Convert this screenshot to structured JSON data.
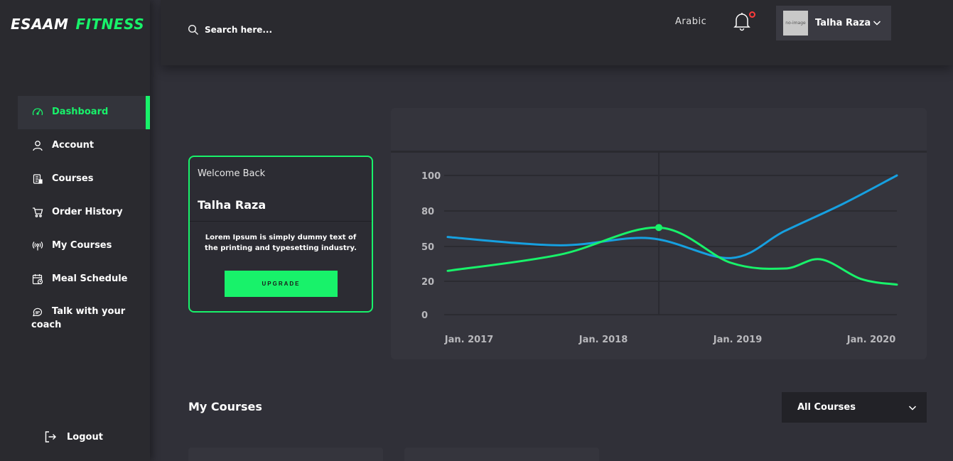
{
  "brand": {
    "part1": "ESAAM",
    "part2": "FITNESS",
    "accent": "#18f26a"
  },
  "sidebar": {
    "items": [
      {
        "label": "Dashboard",
        "icon": "speedometer-icon",
        "active": true
      },
      {
        "label": "Account",
        "icon": "user-icon"
      },
      {
        "label": "Courses",
        "icon": "clipboard-icon"
      },
      {
        "label": "Order History",
        "icon": "cart-icon"
      },
      {
        "label": "My Courses",
        "icon": "broadcast-icon"
      },
      {
        "label": "Meal Schedule",
        "icon": "calendar-icon"
      },
      {
        "label_line1": "Talk with your",
        "label_line2": "coach",
        "icon": "chat-icon"
      }
    ],
    "logout": "Logout"
  },
  "header": {
    "search_placeholder": "Search here...",
    "language": "Arabic",
    "user_name": "Talha Raza",
    "avatar_text": "no-image"
  },
  "welcome": {
    "greeting": "Welcome Back",
    "name": "Talha Raza",
    "description": "Lorem Ipsum is simply dummy text of the printing and typesetting industry.",
    "button": "UPGRADE"
  },
  "chart_data": {
    "type": "line",
    "title": "",
    "x_labels": [
      "Jan. 2017",
      "Jan. 2018",
      "Jan. 2019",
      "Jan. 2020"
    ],
    "y_ticks": [
      0,
      20,
      50,
      80,
      100
    ],
    "ylim": [
      0,
      100
    ],
    "grid": true,
    "legend": "none",
    "series": [
      {
        "color": "#16a0e0",
        "points": [
          [
            0.0,
            58
          ],
          [
            0.25,
            51
          ],
          [
            0.45,
            57
          ],
          [
            0.63,
            40
          ],
          [
            0.75,
            63
          ],
          [
            0.88,
            84
          ],
          [
            1.0,
            100
          ]
        ]
      },
      {
        "color": "#18f26a",
        "points": [
          [
            0.0,
            29
          ],
          [
            0.25,
            43
          ],
          [
            0.47,
            66
          ],
          [
            0.63,
            36
          ],
          [
            0.75,
            31
          ],
          [
            0.83,
            39
          ],
          [
            0.92,
            22
          ],
          [
            1.0,
            18
          ]
        ]
      }
    ],
    "highlight_point": {
      "x": 0.47,
      "y": 66
    }
  },
  "my_courses": {
    "title": "My Courses",
    "filter": "All Courses"
  }
}
